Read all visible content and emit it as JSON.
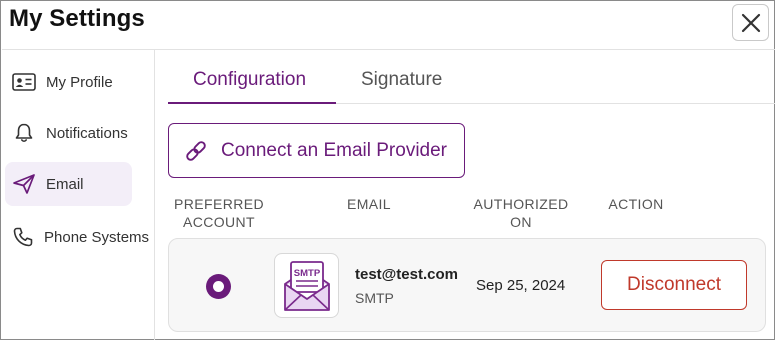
{
  "dialog": {
    "title": "My Settings"
  },
  "sidebar": {
    "items": [
      {
        "label": "My Profile",
        "icon": "profile-card-icon",
        "active": false
      },
      {
        "label": "Notifications",
        "icon": "bell-icon",
        "active": false
      },
      {
        "label": "Email",
        "icon": "paper-plane-icon",
        "active": true
      },
      {
        "label": "Phone Systems",
        "icon": "phone-icon",
        "active": false
      }
    ]
  },
  "tabs": [
    {
      "label": "Configuration",
      "active": true
    },
    {
      "label": "Signature",
      "active": false
    }
  ],
  "connect_button": {
    "label": "Connect an Email Provider",
    "icon": "link-icon"
  },
  "table": {
    "headers": {
      "preferred_line1": "PREFERRED",
      "preferred_line2": "ACCOUNT",
      "email": "EMAIL",
      "authorized_line1": "AUTHORIZED",
      "authorized_line2": "ON",
      "action": "ACTION"
    },
    "rows": [
      {
        "preferred": true,
        "provider_logo_text": "SMTP",
        "email": "test@test.com",
        "provider": "SMTP",
        "authorized_on": "Sep 25, 2024",
        "action_label": "Disconnect"
      }
    ]
  },
  "colors": {
    "accent": "#6a1b7a",
    "danger": "#c0392b",
    "active_nav_bg": "#f3eef8"
  }
}
